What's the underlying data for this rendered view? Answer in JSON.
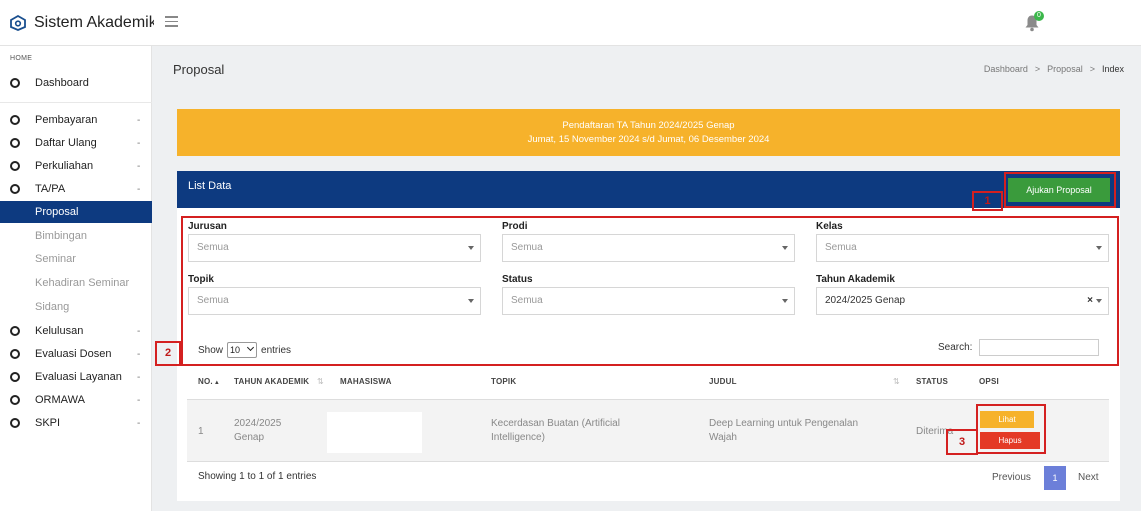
{
  "header": {
    "app_title": "Sistem Akademik",
    "notification_count": "0"
  },
  "sidebar": {
    "section_home": "HOME",
    "items": [
      {
        "label": "Dashboard"
      },
      {
        "label": "Pembayaran",
        "suffix": "-"
      },
      {
        "label": "Daftar Ulang",
        "suffix": "-"
      },
      {
        "label": "Perkuliahan",
        "suffix": "-"
      },
      {
        "label": "TA/PA",
        "suffix": "-"
      },
      {
        "label": "Proposal"
      },
      {
        "label": "Bimbingan"
      },
      {
        "label": "Seminar"
      },
      {
        "label": "Kehadiran Seminar"
      },
      {
        "label": "Sidang"
      },
      {
        "label": "Kelulusan",
        "suffix": "-"
      },
      {
        "label": "Evaluasi Dosen",
        "suffix": "-"
      },
      {
        "label": "Evaluasi Layanan",
        "suffix": "-"
      },
      {
        "label": "ORMAWA",
        "suffix": "-"
      },
      {
        "label": "SKPI",
        "suffix": "-"
      }
    ]
  },
  "page": {
    "title": "Proposal",
    "breadcrumb": [
      "Dashboard",
      ">",
      "Proposal",
      ">",
      "Index"
    ]
  },
  "alert": {
    "line1": "Pendaftaran TA Tahun 2024/2025 Genap",
    "line2": "Jumat, 15 November 2024 s/d Jumat, 06 Desember 2024"
  },
  "card": {
    "title": "List Data",
    "submit_button": "Ajukan Proposal"
  },
  "filters": {
    "jurusan": {
      "label": "Jurusan",
      "value": "Semua"
    },
    "prodi": {
      "label": "Prodi",
      "value": "Semua"
    },
    "kelas": {
      "label": "Kelas",
      "value": "Semua"
    },
    "topik": {
      "label": "Topik",
      "value": "Semua"
    },
    "status": {
      "label": "Status",
      "value": "Semua"
    },
    "tahun_akademik": {
      "label": "Tahun Akademik",
      "value": "2024/2025 Genap",
      "clear": "×"
    }
  },
  "table_controls": {
    "show_label": "Show",
    "entries_value": "10",
    "entries_label": "entries",
    "search_label": "Search:"
  },
  "table": {
    "headers": [
      "NO.",
      "TAHUN AKADEMIK",
      "MAHASISWA",
      "TOPIK",
      "JUDUL",
      "STATUS",
      "OPSI"
    ],
    "sort_up": "▲",
    "sort_both": "⇅",
    "rows": [
      {
        "no": "1",
        "tahun_line1": "2024/2025",
        "tahun_line2": "Genap",
        "topik_line1": "Kecerdasan Buatan (Artificial",
        "topik_line2": "Intelligence)",
        "judul_line1": "Deep Learning untuk Pengenalan",
        "judul_line2": "Wajah",
        "status": "Diterima",
        "btn_view": "Lihat",
        "btn_delete": "Hapus"
      }
    ]
  },
  "footer": {
    "showing": "Showing 1 to 1 of 1 entries",
    "previous": "Previous",
    "page": "1",
    "next": "Next"
  },
  "annotations": [
    "1",
    "2",
    "3"
  ],
  "colors": {
    "primary": "#0d3a80",
    "alert": "#f6b22b",
    "success": "#3a9b3c",
    "danger": "#e43a26",
    "annotation": "#d42020"
  }
}
